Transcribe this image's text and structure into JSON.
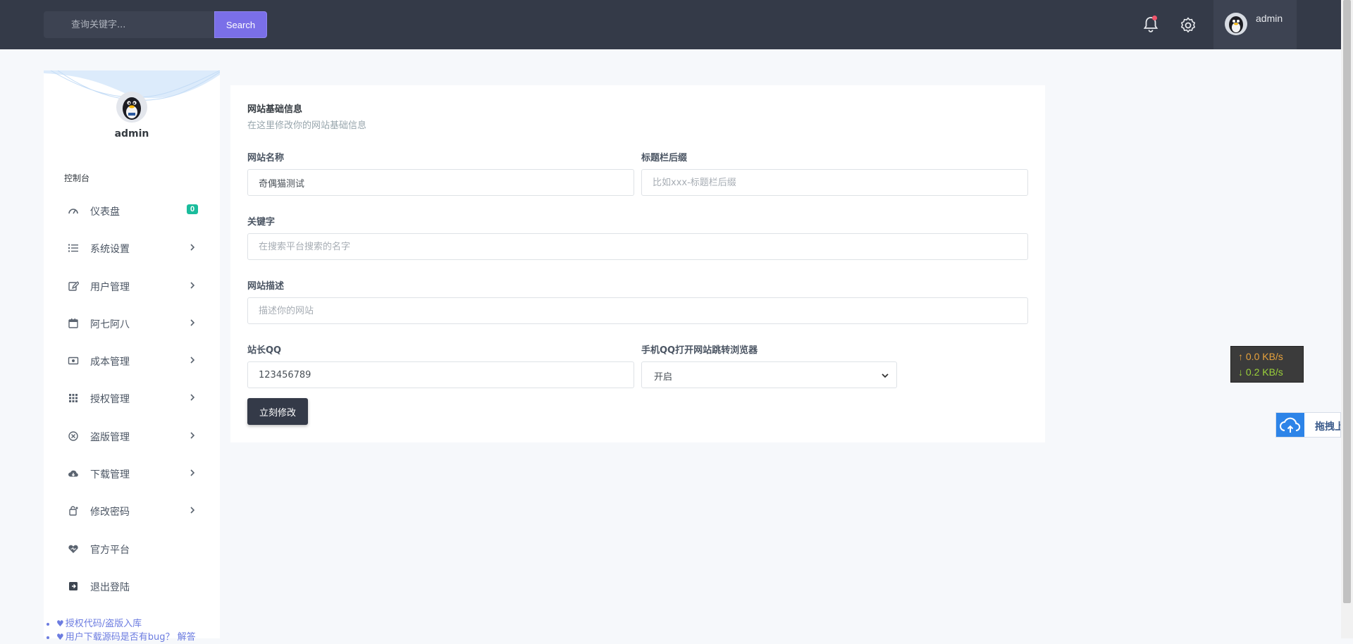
{
  "topbar": {
    "search_placeholder": "查询关键字...",
    "search_button": "Search",
    "user_name": "admin"
  },
  "sidebar": {
    "user_name": "admin",
    "section_title": "控制台",
    "items": [
      {
        "label": "仪表盘",
        "icon": "gauge-icon",
        "badge": "0"
      },
      {
        "label": "系统设置",
        "icon": "list-icon"
      },
      {
        "label": "用户管理",
        "icon": "edit-user-icon"
      },
      {
        "label": "阿七阿八",
        "icon": "calendar-icon"
      },
      {
        "label": "成本管理",
        "icon": "money-icon"
      },
      {
        "label": "授权管理",
        "icon": "grid-icon"
      },
      {
        "label": "盗版管理",
        "icon": "close-circle-icon"
      },
      {
        "label": "下载管理",
        "icon": "cloud-download-icon"
      },
      {
        "label": "修改密码",
        "icon": "refresh-lock-icon"
      },
      {
        "label": "官方平台",
        "icon": "heart-icon"
      },
      {
        "label": "退出登陆",
        "icon": "logout-icon"
      }
    ],
    "links": [
      "授权代码/盗版入库",
      "用户下载源码是否有bug？ 解答"
    ]
  },
  "form": {
    "title": "网站基础信息",
    "subtitle": "在这里修改你的网站基础信息",
    "site_name_label": "网站名称",
    "site_name_value": "奇偶猫测试",
    "title_suffix_label": "标题栏后缀",
    "title_suffix_placeholder": "比如xxx-标题栏后缀",
    "keywords_label": "关键字",
    "keywords_placeholder": "在搜索平台搜索的名字",
    "description_label": "网站描述",
    "description_placeholder": "描述你的网站",
    "qq_label": "站长QQ",
    "qq_value": "123456789",
    "mobile_qq_label": "手机QQ打开网站跳转浏览器",
    "mobile_qq_value": "开启",
    "submit_label": "立刻修改"
  },
  "widgets": {
    "upload_speed": "↑ 0.0 KB/s",
    "download_speed": "↓ 0.2 KB/s",
    "upload_text": "拖拽上传"
  },
  "colors": {
    "topbar": "#343a48",
    "accent": "#7a6fe8",
    "badge": "#1abc9c"
  }
}
